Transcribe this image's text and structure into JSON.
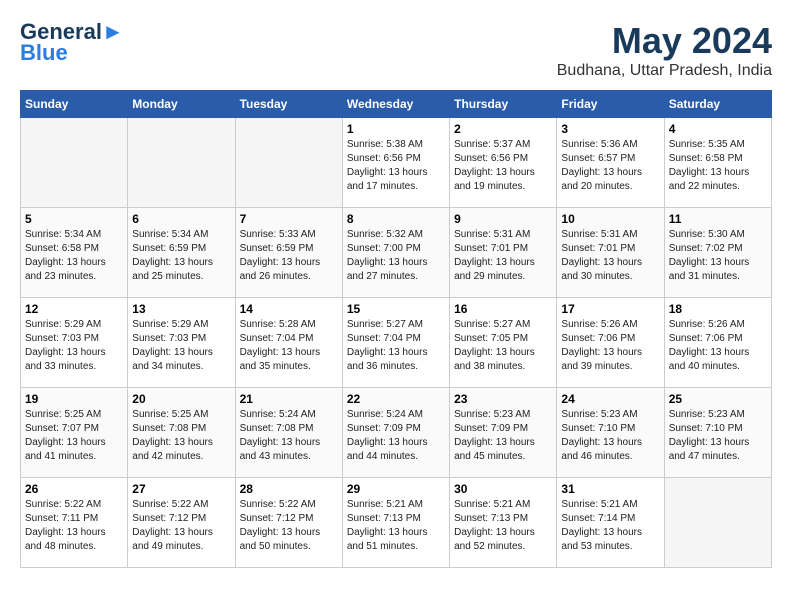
{
  "header": {
    "logo_line1": "General",
    "logo_line2": "Blue",
    "main_title": "May 2024",
    "subtitle": "Budhana, Uttar Pradesh, India"
  },
  "calendar": {
    "days_of_week": [
      "Sunday",
      "Monday",
      "Tuesday",
      "Wednesday",
      "Thursday",
      "Friday",
      "Saturday"
    ],
    "weeks": [
      [
        {
          "day": "",
          "empty": true
        },
        {
          "day": "",
          "empty": true
        },
        {
          "day": "",
          "empty": true
        },
        {
          "day": "1",
          "sunrise": "5:38 AM",
          "sunset": "6:56 PM",
          "daylight": "13 hours and 17 minutes."
        },
        {
          "day": "2",
          "sunrise": "5:37 AM",
          "sunset": "6:56 PM",
          "daylight": "13 hours and 19 minutes."
        },
        {
          "day": "3",
          "sunrise": "5:36 AM",
          "sunset": "6:57 PM",
          "daylight": "13 hours and 20 minutes."
        },
        {
          "day": "4",
          "sunrise": "5:35 AM",
          "sunset": "6:58 PM",
          "daylight": "13 hours and 22 minutes."
        }
      ],
      [
        {
          "day": "5",
          "sunrise": "5:34 AM",
          "sunset": "6:58 PM",
          "daylight": "13 hours and 23 minutes."
        },
        {
          "day": "6",
          "sunrise": "5:34 AM",
          "sunset": "6:59 PM",
          "daylight": "13 hours and 25 minutes."
        },
        {
          "day": "7",
          "sunrise": "5:33 AM",
          "sunset": "6:59 PM",
          "daylight": "13 hours and 26 minutes."
        },
        {
          "day": "8",
          "sunrise": "5:32 AM",
          "sunset": "7:00 PM",
          "daylight": "13 hours and 27 minutes."
        },
        {
          "day": "9",
          "sunrise": "5:31 AM",
          "sunset": "7:01 PM",
          "daylight": "13 hours and 29 minutes."
        },
        {
          "day": "10",
          "sunrise": "5:31 AM",
          "sunset": "7:01 PM",
          "daylight": "13 hours and 30 minutes."
        },
        {
          "day": "11",
          "sunrise": "5:30 AM",
          "sunset": "7:02 PM",
          "daylight": "13 hours and 31 minutes."
        }
      ],
      [
        {
          "day": "12",
          "sunrise": "5:29 AM",
          "sunset": "7:03 PM",
          "daylight": "13 hours and 33 minutes."
        },
        {
          "day": "13",
          "sunrise": "5:29 AM",
          "sunset": "7:03 PM",
          "daylight": "13 hours and 34 minutes."
        },
        {
          "day": "14",
          "sunrise": "5:28 AM",
          "sunset": "7:04 PM",
          "daylight": "13 hours and 35 minutes."
        },
        {
          "day": "15",
          "sunrise": "5:27 AM",
          "sunset": "7:04 PM",
          "daylight": "13 hours and 36 minutes."
        },
        {
          "day": "16",
          "sunrise": "5:27 AM",
          "sunset": "7:05 PM",
          "daylight": "13 hours and 38 minutes."
        },
        {
          "day": "17",
          "sunrise": "5:26 AM",
          "sunset": "7:06 PM",
          "daylight": "13 hours and 39 minutes."
        },
        {
          "day": "18",
          "sunrise": "5:26 AM",
          "sunset": "7:06 PM",
          "daylight": "13 hours and 40 minutes."
        }
      ],
      [
        {
          "day": "19",
          "sunrise": "5:25 AM",
          "sunset": "7:07 PM",
          "daylight": "13 hours and 41 minutes."
        },
        {
          "day": "20",
          "sunrise": "5:25 AM",
          "sunset": "7:08 PM",
          "daylight": "13 hours and 42 minutes."
        },
        {
          "day": "21",
          "sunrise": "5:24 AM",
          "sunset": "7:08 PM",
          "daylight": "13 hours and 43 minutes."
        },
        {
          "day": "22",
          "sunrise": "5:24 AM",
          "sunset": "7:09 PM",
          "daylight": "13 hours and 44 minutes."
        },
        {
          "day": "23",
          "sunrise": "5:23 AM",
          "sunset": "7:09 PM",
          "daylight": "13 hours and 45 minutes."
        },
        {
          "day": "24",
          "sunrise": "5:23 AM",
          "sunset": "7:10 PM",
          "daylight": "13 hours and 46 minutes."
        },
        {
          "day": "25",
          "sunrise": "5:23 AM",
          "sunset": "7:10 PM",
          "daylight": "13 hours and 47 minutes."
        }
      ],
      [
        {
          "day": "26",
          "sunrise": "5:22 AM",
          "sunset": "7:11 PM",
          "daylight": "13 hours and 48 minutes."
        },
        {
          "day": "27",
          "sunrise": "5:22 AM",
          "sunset": "7:12 PM",
          "daylight": "13 hours and 49 minutes."
        },
        {
          "day": "28",
          "sunrise": "5:22 AM",
          "sunset": "7:12 PM",
          "daylight": "13 hours and 50 minutes."
        },
        {
          "day": "29",
          "sunrise": "5:21 AM",
          "sunset": "7:13 PM",
          "daylight": "13 hours and 51 minutes."
        },
        {
          "day": "30",
          "sunrise": "5:21 AM",
          "sunset": "7:13 PM",
          "daylight": "13 hours and 52 minutes."
        },
        {
          "day": "31",
          "sunrise": "5:21 AM",
          "sunset": "7:14 PM",
          "daylight": "13 hours and 53 minutes."
        },
        {
          "day": "",
          "empty": true
        }
      ]
    ]
  }
}
